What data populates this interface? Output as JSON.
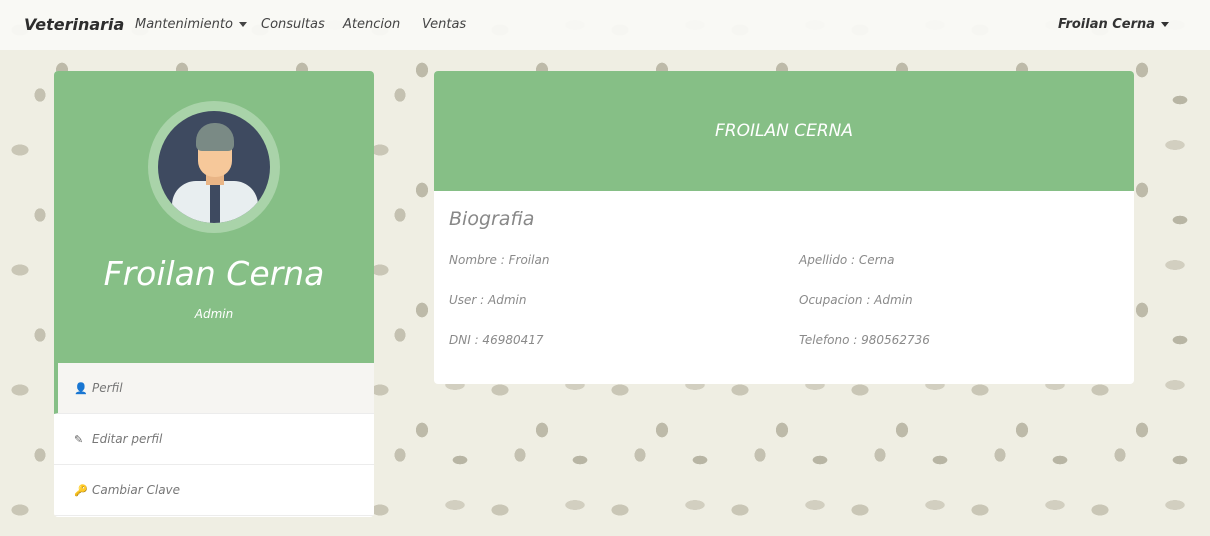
{
  "navbar": {
    "brand": "Veterinaria",
    "links": [
      "Mantenimiento",
      "Consultas",
      "Atencion",
      "Ventas"
    ],
    "user": "Froilan Cerna"
  },
  "profile": {
    "name": "Froilan Cerna",
    "role": "Admin",
    "menu": [
      {
        "label": "Perfil",
        "icon": "user-icon"
      },
      {
        "label": "Editar perfil",
        "icon": "edit-icon"
      },
      {
        "label": "Cambiar Clave",
        "icon": "key-icon"
      }
    ]
  },
  "bio": {
    "header": "FROILAN CERNA",
    "title": "Biografia",
    "fields": {
      "nombre": "Nombre : Froilan",
      "apellido": "Apellido : Cerna",
      "user": "User : Admin",
      "ocupacion": "Ocupacion : Admin",
      "dni": "DNI : 46980417",
      "telefono": "Telefono : 980562736"
    }
  },
  "colors": {
    "accent": "#86bf86",
    "background": "#efeee3"
  }
}
